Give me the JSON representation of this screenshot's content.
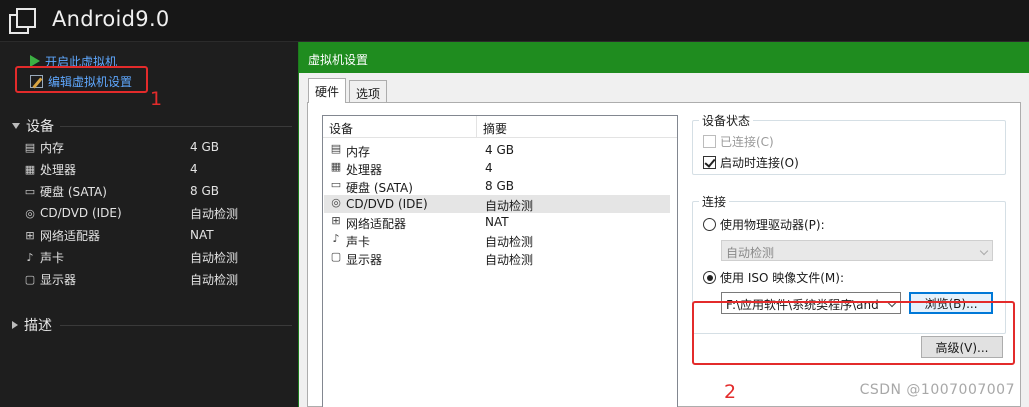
{
  "app": {
    "vm_name": "Android9.0"
  },
  "actions": {
    "start": "开启此虚拟机",
    "edit": "编辑虚拟机设置"
  },
  "annotations": {
    "one": "1",
    "two": "2"
  },
  "left_sections": {
    "devices": "设备",
    "description": "描述"
  },
  "left_devices": [
    {
      "icon": "memory-icon",
      "name": "内存",
      "value": "4 GB"
    },
    {
      "icon": "cpu-icon",
      "name": "处理器",
      "value": "4"
    },
    {
      "icon": "hard-disk-icon",
      "name": "硬盘 (SATA)",
      "value": "8 GB"
    },
    {
      "icon": "cd-dvd-icon",
      "name": "CD/DVD (IDE)",
      "value": "自动检测"
    },
    {
      "icon": "network-adapter-icon",
      "name": "网络适配器",
      "value": "NAT"
    },
    {
      "icon": "sound-card-icon",
      "name": "声卡",
      "value": "自动检测"
    },
    {
      "icon": "display-icon",
      "name": "显示器",
      "value": "自动检测"
    }
  ],
  "dialog": {
    "title": "虚拟机设置",
    "tabs": [
      "硬件",
      "选项"
    ],
    "list_headers": {
      "device": "设备",
      "summary": "摘要"
    },
    "devices": [
      {
        "icon": "memory-icon",
        "name": "内存",
        "value": "4 GB"
      },
      {
        "icon": "cpu-icon",
        "name": "处理器",
        "value": "4"
      },
      {
        "icon": "hard-disk-icon",
        "name": "硬盘 (SATA)",
        "value": "8 GB"
      },
      {
        "icon": "cd-dvd-icon",
        "name": "CD/DVD (IDE)",
        "value": "自动检测"
      },
      {
        "icon": "network-adapter-icon",
        "name": "网络适配器",
        "value": "NAT"
      },
      {
        "icon": "sound-card-icon",
        "name": "声卡",
        "value": "自动检测"
      },
      {
        "icon": "display-icon",
        "name": "显示器",
        "value": "自动检测"
      }
    ],
    "selected_device_index": 3,
    "device_status": {
      "label": "设备状态",
      "connected": "已连接(C)",
      "connected_checked": false,
      "connect_on_power": "启动时连接(O)",
      "connect_on_power_checked": true
    },
    "connection": {
      "label": "连接",
      "physical_drive": "使用物理驱动器(P):",
      "physical_drive_value": "自动检测",
      "iso_file": "使用 ISO 映像文件(M):",
      "iso_path": "F:\\应用软件\\系统类程序\\and",
      "browse": "浏览(B)..."
    },
    "advanced": "高级(V)..."
  },
  "watermark": "CSDN @1007007007"
}
